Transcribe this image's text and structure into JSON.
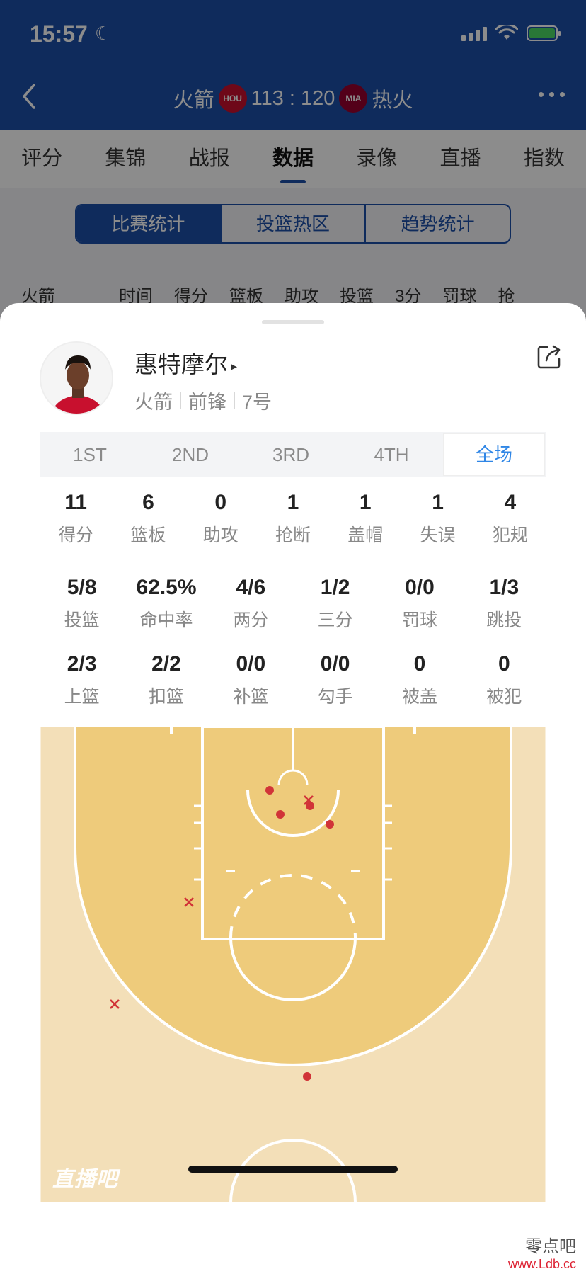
{
  "status_bar": {
    "time": "15:57"
  },
  "game_header": {
    "home_team": "火箭",
    "home_logo_text": "HOU",
    "score": "113 : 120",
    "away_logo_text": "MIA",
    "away_team": "热火"
  },
  "tabs": [
    {
      "label": "评分"
    },
    {
      "label": "集锦"
    },
    {
      "label": "战报"
    },
    {
      "label": "数据",
      "active": true
    },
    {
      "label": "录像"
    },
    {
      "label": "直播"
    },
    {
      "label": "指数"
    }
  ],
  "segments": [
    {
      "label": "比赛统计",
      "active": true
    },
    {
      "label": "投篮热区"
    },
    {
      "label": "趋势统计"
    }
  ],
  "bg_table_header": [
    "火箭",
    "时间",
    "得分",
    "篮板",
    "助攻",
    "投篮",
    "3分",
    "罚球",
    "抢"
  ],
  "player": {
    "name": "惠特摩尔",
    "team": "火箭",
    "position": "前锋",
    "number": "7号"
  },
  "period_tabs": [
    {
      "label": "1ST"
    },
    {
      "label": "2ND"
    },
    {
      "label": "3RD"
    },
    {
      "label": "4TH"
    },
    {
      "label": "全场",
      "active": true
    }
  ],
  "stats_row1": [
    {
      "value": "11",
      "label": "得分"
    },
    {
      "value": "6",
      "label": "篮板"
    },
    {
      "value": "0",
      "label": "助攻"
    },
    {
      "value": "1",
      "label": "抢断"
    },
    {
      "value": "1",
      "label": "盖帽"
    },
    {
      "value": "1",
      "label": "失误"
    },
    {
      "value": "4",
      "label": "犯规"
    }
  ],
  "stats_row2": [
    {
      "value": "5/8",
      "label": "投篮"
    },
    {
      "value": "62.5%",
      "label": "命中率"
    },
    {
      "value": "4/6",
      "label": "两分"
    },
    {
      "value": "1/2",
      "label": "三分"
    },
    {
      "value": "0/0",
      "label": "罚球"
    },
    {
      "value": "1/3",
      "label": "跳投"
    }
  ],
  "stats_row3": [
    {
      "value": "2/3",
      "label": "上篮"
    },
    {
      "value": "2/2",
      "label": "扣篮"
    },
    {
      "value": "0/0",
      "label": "补篮"
    },
    {
      "value": "0/0",
      "label": "勾手"
    },
    {
      "value": "0",
      "label": "被盖"
    },
    {
      "value": "0",
      "label": "被犯"
    }
  ],
  "court_watermark": "直播吧",
  "corner_watermark": {
    "text": "零点吧",
    "url": "www.Ldb.cc"
  },
  "colors": {
    "brand_blue": "#1d4fa8",
    "accent_blue": "#2f86e6",
    "court_outer": "#f3dfb8",
    "court_inner": "#eecb7b",
    "made_shot": "#d13438",
    "missed_shot": "#d13438"
  }
}
